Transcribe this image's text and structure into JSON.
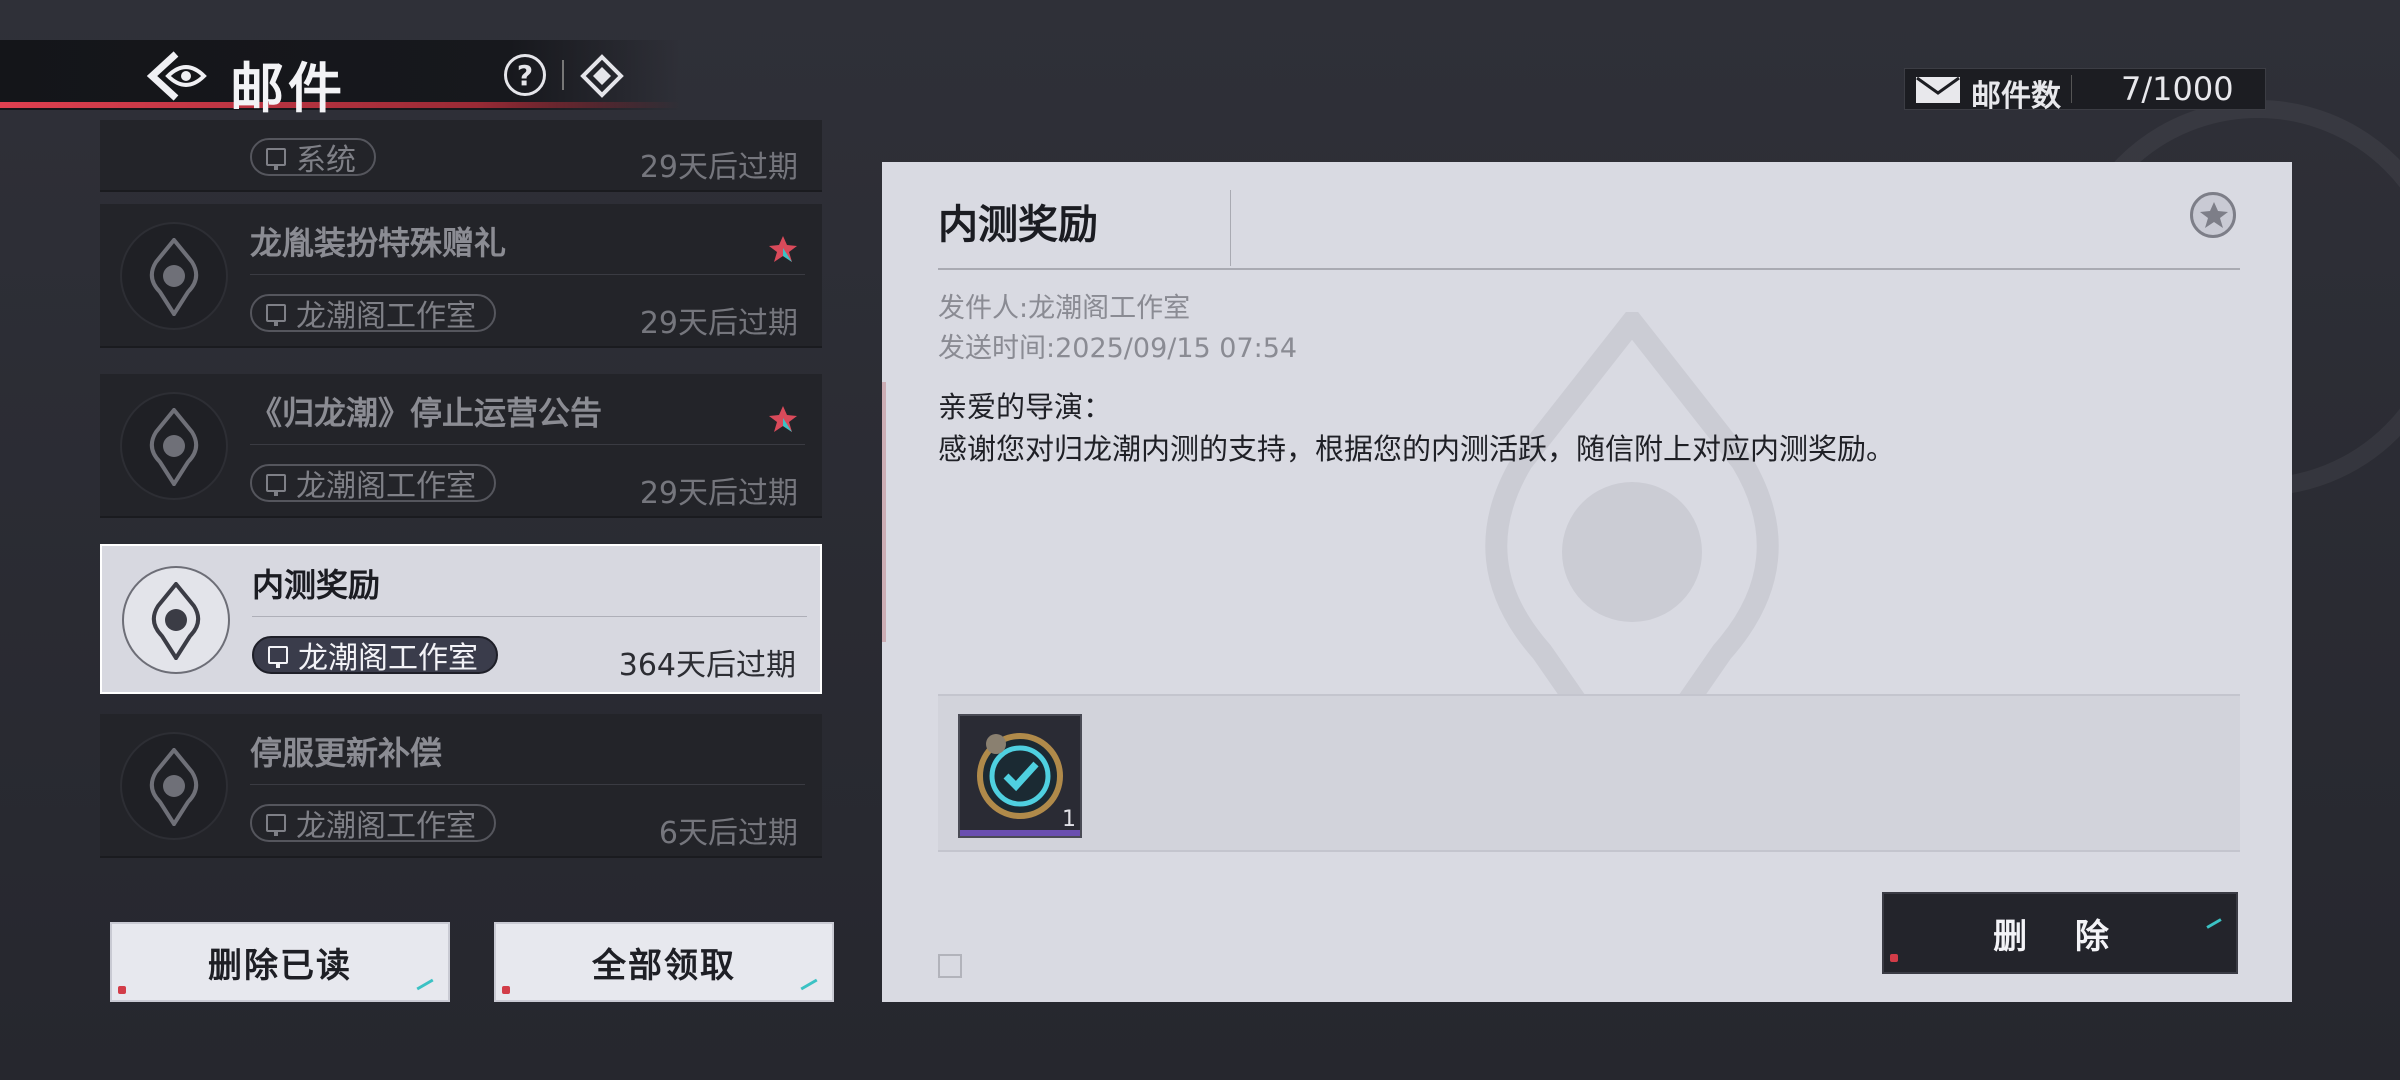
{
  "header": {
    "title": "邮件",
    "help_glyph": "?"
  },
  "mail_count": {
    "label": "邮件数",
    "value": "7/1000"
  },
  "mail_list": [
    {
      "title": "",
      "sender": "系统",
      "expiry": "29天后过期",
      "starred": false,
      "partial": true
    },
    {
      "title": "龙胤装扮特殊赠礼",
      "sender": "龙潮阁工作室",
      "expiry": "29天后过期",
      "starred": true
    },
    {
      "title": "《归龙潮》停止运营公告",
      "sender": "龙潮阁工作室",
      "expiry": "29天后过期",
      "starred": true
    },
    {
      "title": "内测奖励",
      "sender": "龙潮阁工作室",
      "expiry": "364天后过期",
      "starred": false,
      "selected": true
    },
    {
      "title": "停服更新补偿",
      "sender": "龙潮阁工作室",
      "expiry": "6天后过期",
      "starred": false
    }
  ],
  "buttons": {
    "delete_read": "删除已读",
    "claim_all": "全部领取",
    "delete": "删 除"
  },
  "detail": {
    "title": "内测奖励",
    "sender_line": "发件人:龙潮阁工作室",
    "time_line": "发送时间:2025/09/15 07:54",
    "greeting": "亲爱的导演：",
    "body": "感谢您对归龙潮内测的支持，根据您的内测活跃，随信附上对应内测奖励。",
    "attachments": [
      {
        "icon": "checkmark-badge-icon",
        "quantity": "1"
      }
    ]
  },
  "colors": {
    "star": "#d94a5a",
    "star_accent": "#3bc2c4",
    "accent_red": "#e04050",
    "selected_bg": "#d7d8e0",
    "panel_bg": "#d9dae2"
  }
}
